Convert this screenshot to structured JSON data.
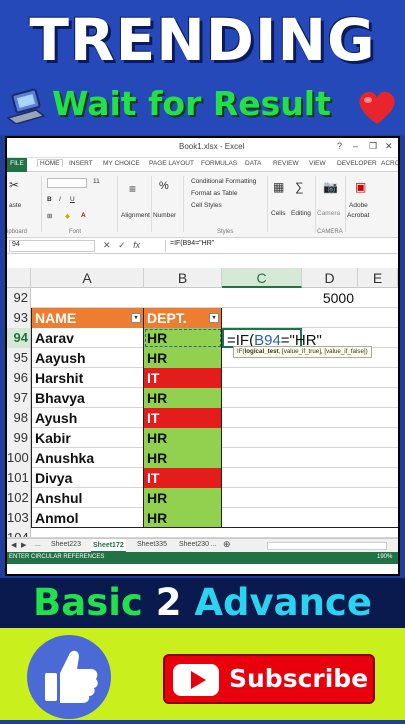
{
  "banner": {
    "title": "TRENDING",
    "subtitle": "Wait for Result",
    "bottom_words": [
      "Basic",
      "2",
      "Advance"
    ],
    "subscribe_label": "Subscribe"
  },
  "excel": {
    "window_title": "Book1.xlsx - Excel",
    "tabs": [
      "FILE",
      "HOME",
      "INSERT",
      "MY CHOICE",
      "PAGE LAYOUT",
      "FORMULAS",
      "DATA",
      "REVIEW",
      "VIEW",
      "DEVELOPER",
      "ACRO"
    ],
    "ribbon": {
      "paste": "aste",
      "clipboard": "ipboard",
      "font_size": "11",
      "font_group": "Font",
      "alignment": "Alignment",
      "number": "Number",
      "number_pct": "%",
      "cond_format": "Conditional Formatting",
      "format_table": "Format as Table",
      "cell_styles": "Cell Styles",
      "styles_group": "Styles",
      "cells": "Cells",
      "editing": "Editing",
      "camera": "Camera",
      "camera_group": "CAMERA",
      "adobe": "Adobe",
      "acrobat": "Acrobat"
    },
    "name_box": "94",
    "formula_bar": "=IF(B94=\"HR\"",
    "columns": [
      "A",
      "B",
      "C",
      "D",
      "E"
    ],
    "rows": [
      {
        "num": "92",
        "a": "",
        "b": "",
        "d": "5000"
      },
      {
        "num": "93",
        "a": "NAME",
        "b": "DEPT.",
        "d": ""
      },
      {
        "num": "94",
        "a": "Aarav",
        "b": "HR",
        "d": ""
      },
      {
        "num": "95",
        "a": "Aayush",
        "b": "HR",
        "d": ""
      },
      {
        "num": "96",
        "a": "Harshit",
        "b": "IT",
        "d": ""
      },
      {
        "num": "97",
        "a": "Bhavya",
        "b": "HR",
        "d": ""
      },
      {
        "num": "98",
        "a": "Ayush",
        "b": "IT",
        "d": ""
      },
      {
        "num": "99",
        "a": "Kabir",
        "b": "HR",
        "d": ""
      },
      {
        "num": "100",
        "a": "Anushka",
        "b": "HR",
        "d": ""
      },
      {
        "num": "101",
        "a": "Divya",
        "b": "IT",
        "d": ""
      },
      {
        "num": "102",
        "a": "Anshul",
        "b": "HR",
        "d": ""
      },
      {
        "num": "103",
        "a": "Anmol",
        "b": "HR",
        "d": ""
      },
      {
        "num": "104",
        "a": "",
        "b": "",
        "d": ""
      }
    ],
    "formula_cell": {
      "prefix": "=IF(",
      "ref": "B94",
      "suffix": "=\"HR\""
    },
    "tooltip": {
      "fn": "IF(",
      "arg1": "logical_test",
      "rest": ", [value_if_true], [value_if_false])"
    },
    "sheet_tabs": [
      "...",
      "Sheet223",
      "Sheet172",
      "Sheet335",
      "Sheet230 ..."
    ],
    "active_sheet": "Sheet172",
    "status": "ENTER   CIRCULAR REFERENCES",
    "zoom": "190%",
    "colors": {
      "excel_green": "#217346",
      "hr_green": "#92d050",
      "it_red": "#e31c1c",
      "header_orange": "#ed7d31"
    }
  }
}
